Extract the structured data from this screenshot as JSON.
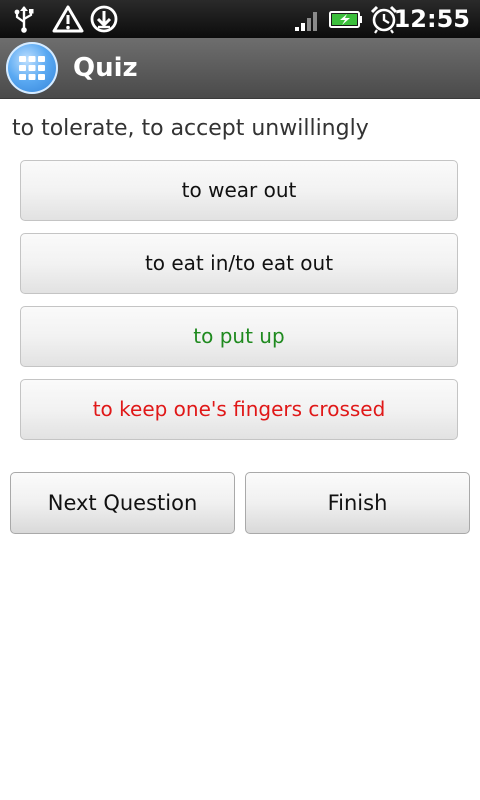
{
  "status_bar": {
    "time": "12:55",
    "icons": [
      "usb-icon",
      "warning-icon",
      "download-icon",
      "signal-icon",
      "battery-icon",
      "alarm-icon"
    ]
  },
  "header": {
    "title": "Quiz",
    "icon": "grid-icon"
  },
  "question": {
    "text": "to tolerate, to accept unwillingly"
  },
  "answers": [
    {
      "label": "to wear out",
      "state": "neutral"
    },
    {
      "label": "to eat in/to eat out",
      "state": "neutral"
    },
    {
      "label": "to put up",
      "state": "correct"
    },
    {
      "label": "to keep one's fingers crossed",
      "state": "wrong"
    }
  ],
  "actions": {
    "next_label": "Next Question",
    "finish_label": "Finish"
  },
  "colors": {
    "correct": "#1f8a1f",
    "wrong": "#e01818",
    "title_bar": "#5a5a5a",
    "status_bar": "#111111"
  }
}
